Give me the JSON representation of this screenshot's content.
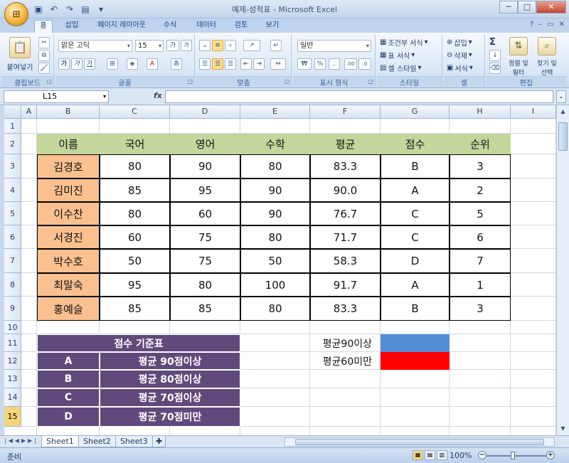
{
  "window": {
    "title": "예제-성적표 - Microsoft Excel",
    "buttons": {
      "minimize": "─",
      "maximize": "□",
      "close": "✕"
    }
  },
  "qat_icons": [
    "excel-logo-icon",
    "save-icon",
    "undo-icon",
    "redo-icon",
    "print-preview-icon",
    "customize-icon"
  ],
  "ribbon": {
    "tabs": [
      "홈",
      "삽입",
      "페이지 레이아웃",
      "수식",
      "데이터",
      "검토",
      "보기"
    ],
    "active_tab": "홈",
    "right_icons": [
      "help-icon",
      "minimize-ribbon-icon",
      "restore-icon",
      "close-workbook-icon"
    ],
    "groups": {
      "clipboard": {
        "label": "클립보드",
        "paste": "붙여넣기"
      },
      "font": {
        "label": "글꼴",
        "font_name": "맑은 고딕",
        "font_size": "15",
        "bold": "가",
        "italic": "가",
        "underline": "가",
        "grow": "가",
        "shrink": "가"
      },
      "alignment": {
        "label": "맞춤"
      },
      "number": {
        "label": "표시 형식",
        "format": "일반",
        "currency": "₩",
        "percent": "%",
        "comma": ",",
        "inc": ".00",
        "dec": ".0"
      },
      "styles": {
        "label": "스타일",
        "conditional": "조건부 서식",
        "table": "표 서식",
        "cell": "셀 스타일"
      },
      "cells": {
        "label": "셀",
        "insert": "삽입",
        "delete": "삭제",
        "format": "서식"
      },
      "editing": {
        "label": "편집",
        "sum": "Σ",
        "sort": "정렬 및 필터",
        "find": "찾기 및 선택"
      }
    }
  },
  "formula_bar": {
    "cell_ref": "L15",
    "fx": "fx",
    "content": ""
  },
  "grid": {
    "columns": [
      "A",
      "B",
      "C",
      "D",
      "E",
      "F",
      "G",
      "H",
      "I"
    ],
    "rows": [
      "1",
      "2",
      "3",
      "4",
      "5",
      "6",
      "7",
      "8",
      "9",
      "10",
      "11",
      "12",
      "13",
      "14",
      "15"
    ],
    "active_row": "15",
    "table": {
      "headers": [
        "이름",
        "국어",
        "영어",
        "수학",
        "평균",
        "점수",
        "순위"
      ],
      "rows": [
        [
          "김경호",
          "80",
          "90",
          "80",
          "83.3",
          "B",
          "3"
        ],
        [
          "김미진",
          "85",
          "95",
          "90",
          "90.0",
          "A",
          "2"
        ],
        [
          "이수찬",
          "80",
          "60",
          "90",
          "76.7",
          "C",
          "5"
        ],
        [
          "서경진",
          "60",
          "75",
          "80",
          "71.7",
          "C",
          "6"
        ],
        [
          "박수호",
          "50",
          "75",
          "50",
          "58.3",
          "D",
          "7"
        ],
        [
          "최말숙",
          "95",
          "80",
          "100",
          "91.7",
          "A",
          "1"
        ],
        [
          "홍예슬",
          "85",
          "85",
          "80",
          "83.3",
          "B",
          "3"
        ]
      ]
    },
    "legend": {
      "title": "점수 기준표",
      "rows": [
        [
          "A",
          "평균 90점이상"
        ],
        [
          "B",
          "평균 80점이상"
        ],
        [
          "C",
          "평균 70점이상"
        ],
        [
          "D",
          "평균 70점미만"
        ]
      ]
    },
    "color_key": [
      {
        "label": "평균90이상",
        "color": "#558ed5"
      },
      {
        "label": "평균60미만",
        "color": "#ff0000"
      }
    ]
  },
  "sheets": {
    "tabs": [
      "Sheet1",
      "Sheet2",
      "Sheet3"
    ],
    "active": "Sheet1"
  },
  "status": {
    "mode": "준비",
    "zoom": "100%"
  },
  "colors": {
    "header_green": "#c3d69b",
    "name_orange": "#fac090",
    "legend_purple": "#604a7b"
  }
}
